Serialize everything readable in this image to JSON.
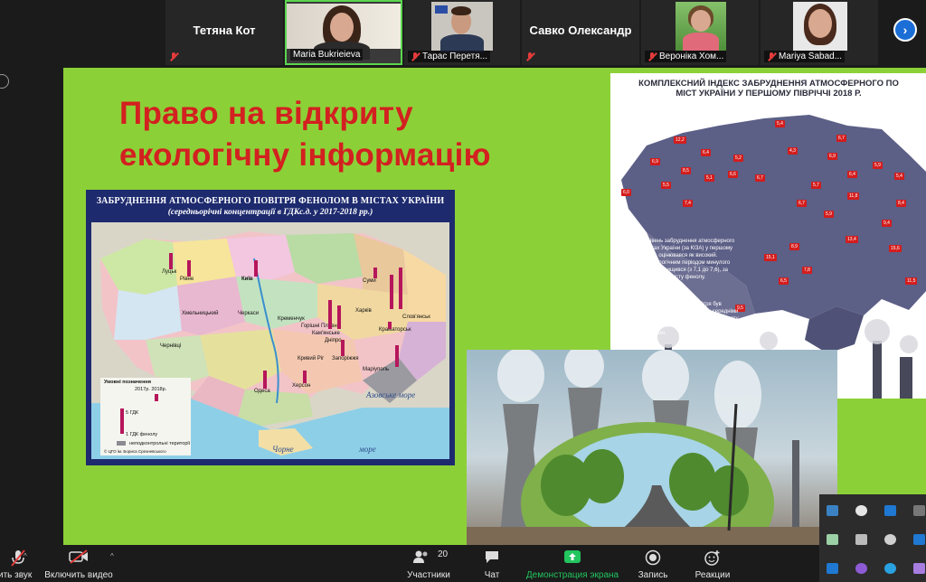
{
  "participants": [
    {
      "name": "Тетяна Кот",
      "muted": true
    },
    {
      "name": "Maria Bukrieieva",
      "muted": false
    },
    {
      "name": "Тарас Перетя...",
      "muted": true
    },
    {
      "name": "Савко Олександр",
      "muted": true
    },
    {
      "name": "Вероніка Хом...",
      "muted": true
    },
    {
      "name": "Mariya Sabad...",
      "muted": true
    }
  ],
  "slide": {
    "title_line1": "Право на відкриту",
    "title_line2": "екологічну інформацію",
    "map1": {
      "title": "ЗАБРУДНЕННЯ АТМОСФЕРНОГО ПОВІТРЯ ФЕНОЛОМ В МІСТАХ УКРАЇНИ",
      "subtitle": "(середньорічні концентрації в ГДКс.д. у 2017-2018 рр.)",
      "cities": [
        "Луцьк",
        "Рівне",
        "Київ",
        "Суми",
        "Харків",
        "Хмельницький",
        "Черкаси",
        "Кременчук",
        "Горішні Плавні",
        "Кам'янське",
        "Дніпро",
        "Слов'янськ",
        "Краматорськ",
        "Чернівці",
        "Кривий Ріг",
        "Запоріжжя",
        "Маріуполь",
        "Одеса",
        "Херсон"
      ],
      "seas": [
        "Азовське море",
        "Чорне",
        "море"
      ],
      "legend_title": "Умовні позначення",
      "legend_years": "2017р. 2018р.",
      "legend_5": "5 ГДК",
      "legend_1": "1 ГДК фенолу",
      "legend_nc": "неподконтрольні території",
      "credit": "© ЦГО ім. Бориса Срезневського"
    },
    "map2": {
      "title_line1": "КОМПЛЕКСНИЙ ІНДЕКС ЗАБРУДНЕННЯ АТМОСФЕРНОГО ПО",
      "title_line2": "МІСТ УКРАЇНИ У ПЕРШОМУ ПІВРІЧЧІ 2018 Р.",
      "text1": "Загальний рівень забруднення атмосферного повітря в містах України (за КІЗА) у першому півріччі 2018 р. оцінювався як високий. Порівняно заналогічним періодом минулого року, він дещо підвищився (з 7,1 до 7,6), за рахунок зростання вмісту фенолу.",
      "text2": "Високий рівень забруднення повітря був обумовлений здебільшого значними середніми концентраціями формальдегіду, діоксиду азоту, фенолу, фтористого водню, оксиду вуглецю, завислих речовин.",
      "badges": [
        "12,2",
        "5,4",
        "6,9",
        "6,4",
        "5,2",
        "6,7",
        "8,5",
        "6,9",
        "6,0",
        "5,1",
        "4,3",
        "6,7",
        "5,9",
        "5,5",
        "6,6",
        "5,4",
        "6,4",
        "5,7",
        "11,8",
        "7,4",
        "6,7",
        "8,4",
        "5,9",
        "9,4",
        "13,4",
        "15,6",
        "8,9",
        "15,1",
        "7,8",
        "6,5",
        "11,5",
        "9,5"
      ]
    }
  },
  "toolbar": {
    "audio_label": "ить звук",
    "video_label": "Включить видео",
    "participants_label": "Участники",
    "participants_count": "20",
    "chat_label": "Чат",
    "share_label": "Демонстрация экрана",
    "record_label": "Запись",
    "reactions_label": "Реакции"
  },
  "colors": {
    "accent_green": "#22c55e",
    "slide_bg": "#8cd037",
    "title_red": "#d32020",
    "mute_red": "#e23b3b",
    "zoom_blue": "#1b6ed6"
  }
}
